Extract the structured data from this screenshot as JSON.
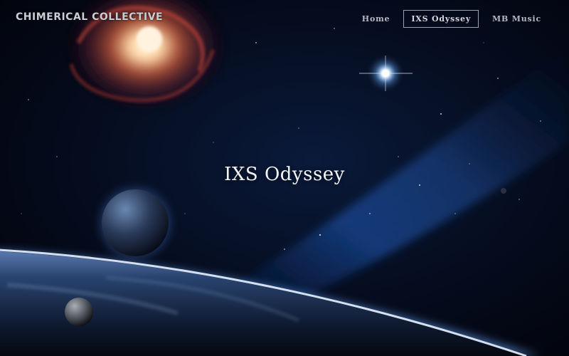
{
  "site": {
    "logo": "CHIMERICAL COLLECTIVE"
  },
  "nav": {
    "items": [
      {
        "label": "Home",
        "active": false
      },
      {
        "label": "IXS Odyssey",
        "active": true
      },
      {
        "label": "MB Music",
        "active": false
      }
    ]
  },
  "hero": {
    "title": "IXS Odyssey",
    "background": "space-scene-image"
  },
  "colors": {
    "background": "#02040a",
    "horizon_glow": "#5a9bff",
    "nav_text": "#b4bac4",
    "title_text": "#f2f4f7"
  }
}
